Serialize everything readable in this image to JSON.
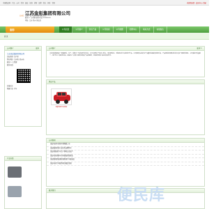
{
  "topbar": {
    "links": [
      "中国精品网",
      "产品",
      "公司",
      "资讯",
      "展会",
      "招商",
      "求购",
      "品牌",
      "供应",
      "问答",
      "专题"
    ],
    "right": "欢迎您来到 · 会员中心 | 登录"
  },
  "header": {
    "logo_text": "五洲汇",
    "company": "江苏金彭集团有限公司",
    "contact_lines": [
      "主营产品: 电动 三轮 四轮 轿车",
      "联系人: 王经理  联系电话: 13xxxxxxx",
      "地址: 江苏 徐州 铜山区"
    ]
  },
  "nav": {
    "brand": "金彭",
    "items": [
      "公司首页",
      "公司简介",
      "供应产品",
      "公司新闻",
      "公司相册",
      "招聘中心",
      "联系方式",
      "在线留言"
    ]
  },
  "searchbar": {
    "label": "首 页"
  },
  "intro": {
    "title": "公司简介",
    "more": "更多",
    "company_name": "江苏金彭集团有限公司",
    "lines": [
      "企业类型: 生产型",
      "所在地区: 江苏省 | 徐州市",
      "联系人: 王经理",
      "联系电话:",
      "所属行业: 汽车"
    ],
    "qr_caption": "扫描关注"
  },
  "category": {
    "title": "产品分类"
  },
  "about": {
    "title": "公司简介",
    "more": "更多>>",
    "text": "江苏金彭集团是一家集研发、生产、销售为一体的现代化企业，公司主要生产电动三轮车、电动四轮车、低速电动汽车等系列产品。公司拥有先进的生产设备和完善的检测手段，产品畅销全国各地并出口多个国家和地区。公司秉承\"质量第一、用户至上\"的经营宗旨，竭诚为广大客户提供优质的产品和服务，欢迎新老客户来电洽谈合作。"
  },
  "products": {
    "title": "供应产品",
    "items": [
      {
        "name": "金彭电动汽车供应"
      }
    ]
  },
  "news": {
    "title": "公司新闻",
    "items": [
      "金彭电动车全新车型隆重上市",
      "金彭集团荣获行业优秀品牌称号",
      "金彭新能源汽车生产基地正式投产",
      "金彭电动四轮车市场销量持续增长",
      "金彭集团参加国际新能源汽车展览会",
      "金彭电动汽车服务网点覆盖全国"
    ]
  },
  "contact": {
    "title": "联系我们"
  },
  "watermark": "便民库"
}
